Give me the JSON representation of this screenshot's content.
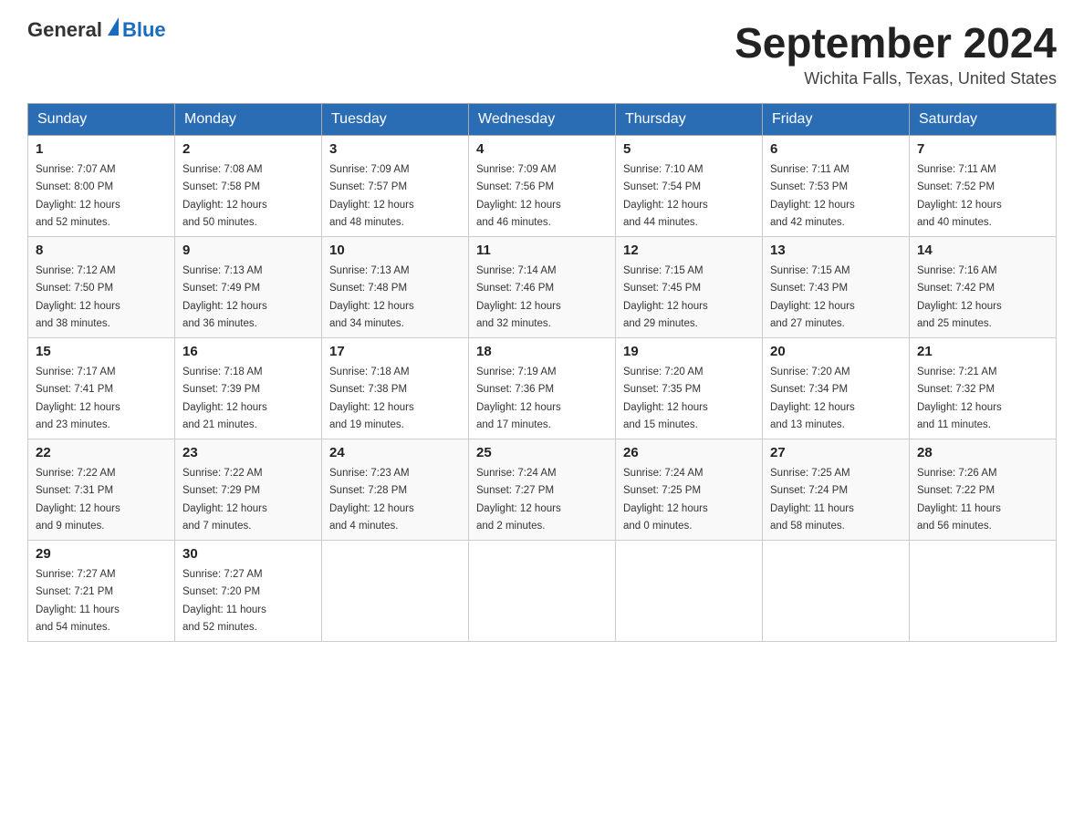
{
  "header": {
    "logo_general": "General",
    "logo_blue": "Blue",
    "month_title": "September 2024",
    "location": "Wichita Falls, Texas, United States"
  },
  "days_of_week": [
    "Sunday",
    "Monday",
    "Tuesday",
    "Wednesday",
    "Thursday",
    "Friday",
    "Saturday"
  ],
  "weeks": [
    [
      {
        "day": "1",
        "sunrise": "7:07 AM",
        "sunset": "8:00 PM",
        "daylight": "12 hours and 52 minutes."
      },
      {
        "day": "2",
        "sunrise": "7:08 AM",
        "sunset": "7:58 PM",
        "daylight": "12 hours and 50 minutes."
      },
      {
        "day": "3",
        "sunrise": "7:09 AM",
        "sunset": "7:57 PM",
        "daylight": "12 hours and 48 minutes."
      },
      {
        "day": "4",
        "sunrise": "7:09 AM",
        "sunset": "7:56 PM",
        "daylight": "12 hours and 46 minutes."
      },
      {
        "day": "5",
        "sunrise": "7:10 AM",
        "sunset": "7:54 PM",
        "daylight": "12 hours and 44 minutes."
      },
      {
        "day": "6",
        "sunrise": "7:11 AM",
        "sunset": "7:53 PM",
        "daylight": "12 hours and 42 minutes."
      },
      {
        "day": "7",
        "sunrise": "7:11 AM",
        "sunset": "7:52 PM",
        "daylight": "12 hours and 40 minutes."
      }
    ],
    [
      {
        "day": "8",
        "sunrise": "7:12 AM",
        "sunset": "7:50 PM",
        "daylight": "12 hours and 38 minutes."
      },
      {
        "day": "9",
        "sunrise": "7:13 AM",
        "sunset": "7:49 PM",
        "daylight": "12 hours and 36 minutes."
      },
      {
        "day": "10",
        "sunrise": "7:13 AM",
        "sunset": "7:48 PM",
        "daylight": "12 hours and 34 minutes."
      },
      {
        "day": "11",
        "sunrise": "7:14 AM",
        "sunset": "7:46 PM",
        "daylight": "12 hours and 32 minutes."
      },
      {
        "day": "12",
        "sunrise": "7:15 AM",
        "sunset": "7:45 PM",
        "daylight": "12 hours and 29 minutes."
      },
      {
        "day": "13",
        "sunrise": "7:15 AM",
        "sunset": "7:43 PM",
        "daylight": "12 hours and 27 minutes."
      },
      {
        "day": "14",
        "sunrise": "7:16 AM",
        "sunset": "7:42 PM",
        "daylight": "12 hours and 25 minutes."
      }
    ],
    [
      {
        "day": "15",
        "sunrise": "7:17 AM",
        "sunset": "7:41 PM",
        "daylight": "12 hours and 23 minutes."
      },
      {
        "day": "16",
        "sunrise": "7:18 AM",
        "sunset": "7:39 PM",
        "daylight": "12 hours and 21 minutes."
      },
      {
        "day": "17",
        "sunrise": "7:18 AM",
        "sunset": "7:38 PM",
        "daylight": "12 hours and 19 minutes."
      },
      {
        "day": "18",
        "sunrise": "7:19 AM",
        "sunset": "7:36 PM",
        "daylight": "12 hours and 17 minutes."
      },
      {
        "day": "19",
        "sunrise": "7:20 AM",
        "sunset": "7:35 PM",
        "daylight": "12 hours and 15 minutes."
      },
      {
        "day": "20",
        "sunrise": "7:20 AM",
        "sunset": "7:34 PM",
        "daylight": "12 hours and 13 minutes."
      },
      {
        "day": "21",
        "sunrise": "7:21 AM",
        "sunset": "7:32 PM",
        "daylight": "12 hours and 11 minutes."
      }
    ],
    [
      {
        "day": "22",
        "sunrise": "7:22 AM",
        "sunset": "7:31 PM",
        "daylight": "12 hours and 9 minutes."
      },
      {
        "day": "23",
        "sunrise": "7:22 AM",
        "sunset": "7:29 PM",
        "daylight": "12 hours and 7 minutes."
      },
      {
        "day": "24",
        "sunrise": "7:23 AM",
        "sunset": "7:28 PM",
        "daylight": "12 hours and 4 minutes."
      },
      {
        "day": "25",
        "sunrise": "7:24 AM",
        "sunset": "7:27 PM",
        "daylight": "12 hours and 2 minutes."
      },
      {
        "day": "26",
        "sunrise": "7:24 AM",
        "sunset": "7:25 PM",
        "daylight": "12 hours and 0 minutes."
      },
      {
        "day": "27",
        "sunrise": "7:25 AM",
        "sunset": "7:24 PM",
        "daylight": "11 hours and 58 minutes."
      },
      {
        "day": "28",
        "sunrise": "7:26 AM",
        "sunset": "7:22 PM",
        "daylight": "11 hours and 56 minutes."
      }
    ],
    [
      {
        "day": "29",
        "sunrise": "7:27 AM",
        "sunset": "7:21 PM",
        "daylight": "11 hours and 54 minutes."
      },
      {
        "day": "30",
        "sunrise": "7:27 AM",
        "sunset": "7:20 PM",
        "daylight": "11 hours and 52 minutes."
      },
      null,
      null,
      null,
      null,
      null
    ]
  ],
  "labels": {
    "sunrise": "Sunrise:",
    "sunset": "Sunset:",
    "daylight": "Daylight:"
  }
}
